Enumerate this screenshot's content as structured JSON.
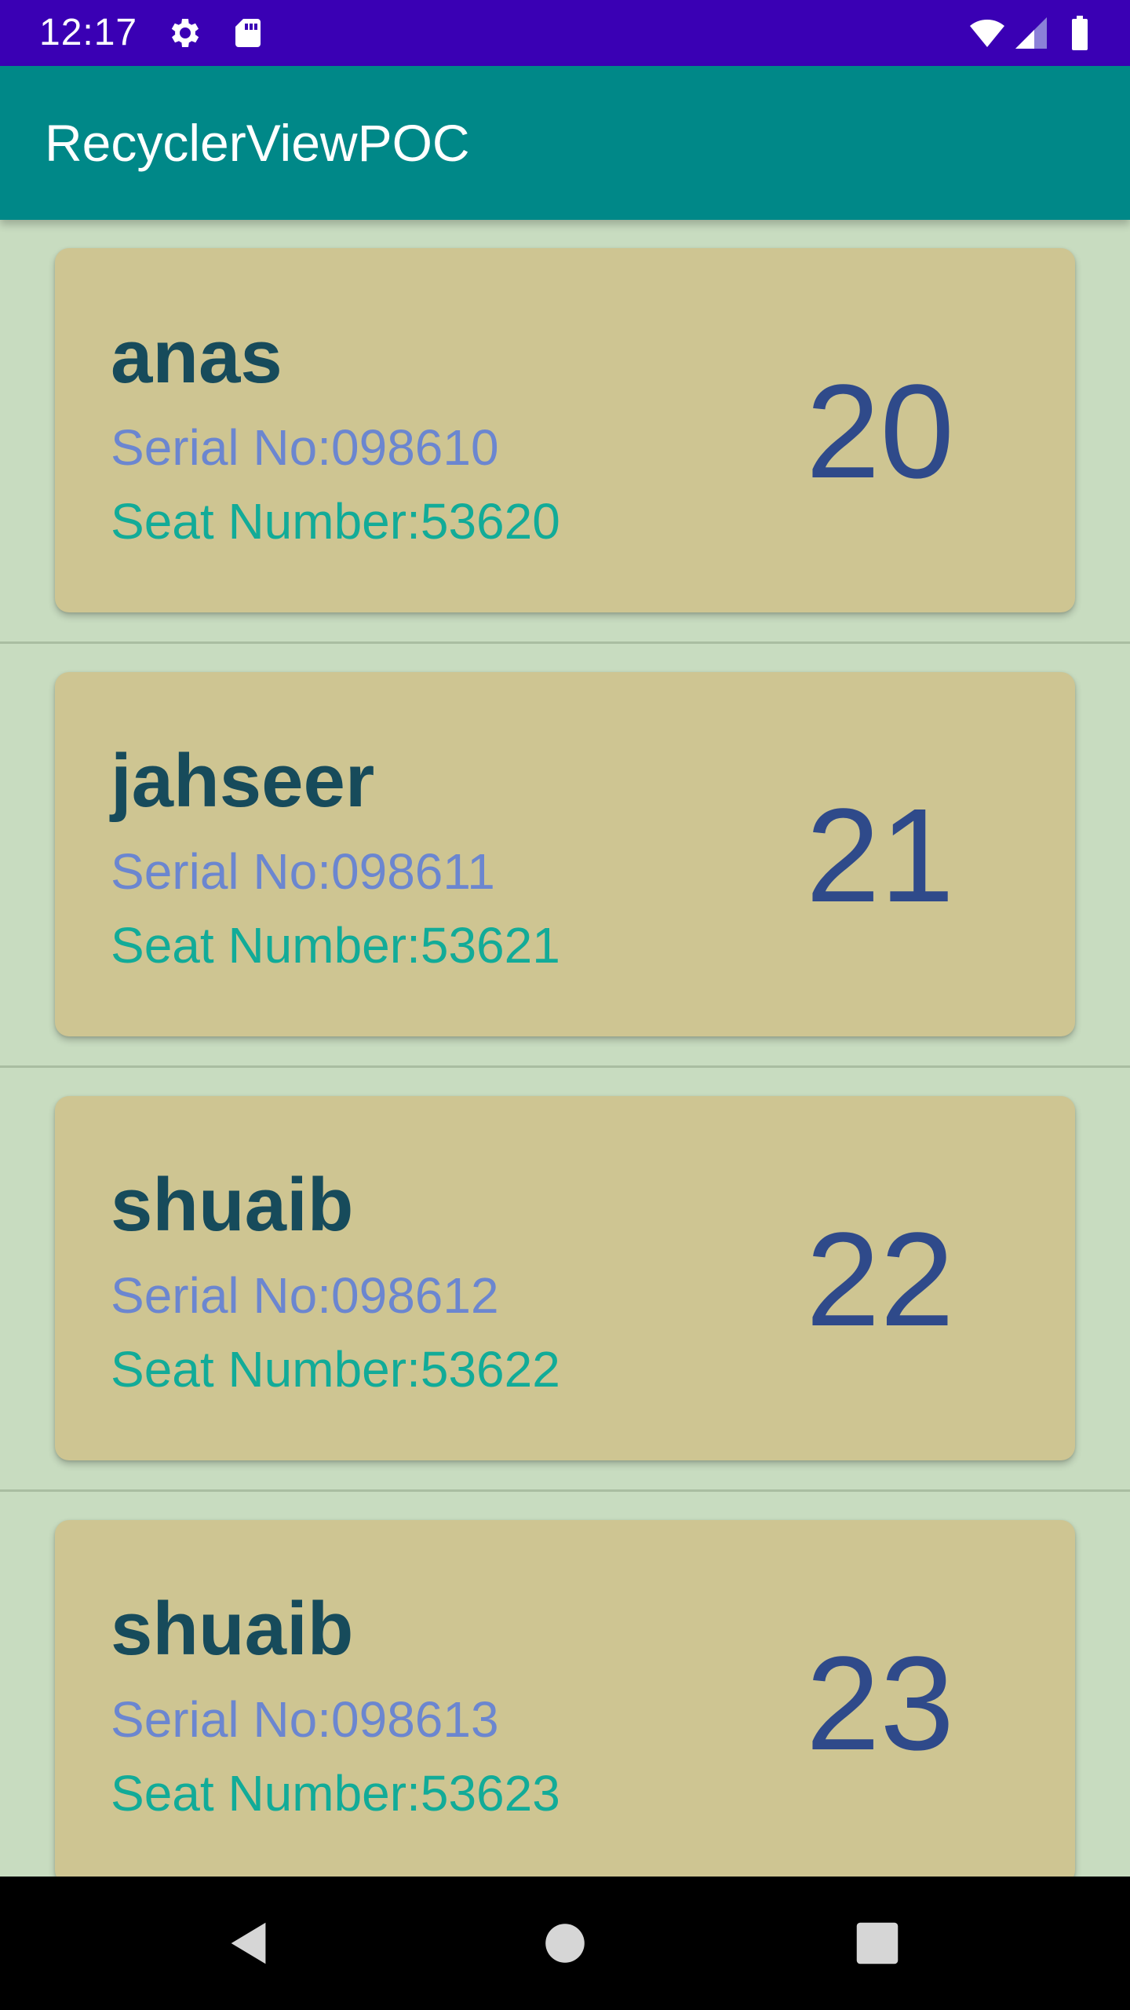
{
  "status_bar": {
    "time": "12:17",
    "icons": [
      "gear-icon",
      "sd-card-icon",
      "wifi-icon",
      "signal-icon",
      "battery-icon"
    ]
  },
  "app_bar": {
    "title": "RecyclerViewPOC"
  },
  "list": {
    "items": [
      {
        "name": "anas",
        "serial": "Serial No:098610",
        "seat": "Seat Number:53620",
        "number": "20"
      },
      {
        "name": "jahseer",
        "serial": "Serial No:098611",
        "seat": "Seat Number:53621",
        "number": "21"
      },
      {
        "name": "shuaib",
        "serial": "Serial No:098612",
        "seat": "Seat Number:53622",
        "number": "22"
      },
      {
        "name": "shuaib",
        "serial": "Serial No:098613",
        "seat": "Seat Number:53623",
        "number": "23"
      }
    ]
  },
  "nav_bar": {
    "icons": [
      "back-icon",
      "home-icon",
      "recents-icon"
    ]
  },
  "colors": {
    "status_bar": "#3a00b4",
    "app_bar": "#008888",
    "background": "#c8dcc0",
    "card": "#cec592",
    "name_text": "#174b5b",
    "serial_text": "#6b86d0",
    "seat_text": "#12ab98",
    "number_text": "#2f4a8a"
  }
}
